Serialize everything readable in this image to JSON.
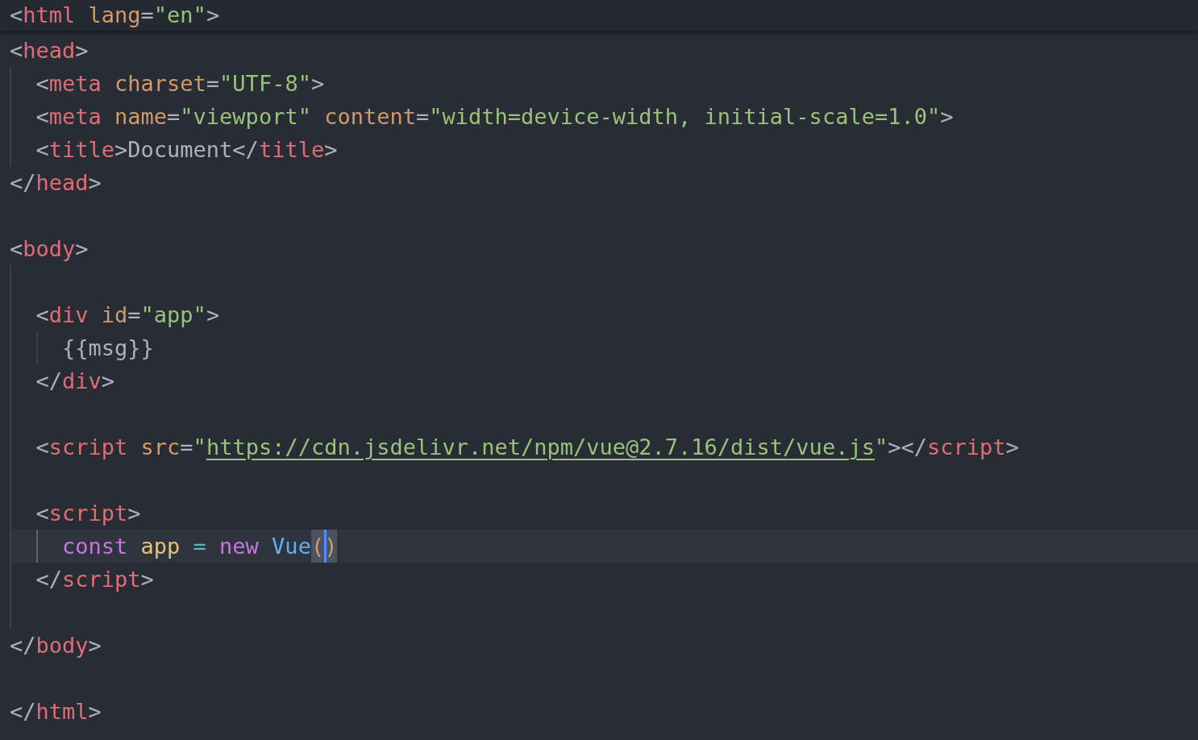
{
  "sticky_line": {
    "tokens": [
      {
        "kind": "punct",
        "text": "<"
      },
      {
        "kind": "tag",
        "text": "html"
      },
      {
        "kind": "attr",
        "text": " lang"
      },
      {
        "kind": "punct",
        "text": "="
      },
      {
        "kind": "string",
        "text": "\"en\""
      },
      {
        "kind": "punct",
        "text": ">"
      }
    ]
  },
  "lines": [
    {
      "kind": "code",
      "tokens": [
        {
          "kind": "punct",
          "text": "<"
        },
        {
          "kind": "tag",
          "text": "head"
        },
        {
          "kind": "punct",
          "text": ">"
        }
      ]
    },
    {
      "kind": "code",
      "tokens": [
        {
          "kind": "guide"
        },
        {
          "kind": "punct",
          "text": "<"
        },
        {
          "kind": "tag",
          "text": "meta"
        },
        {
          "kind": "attr",
          "text": " charset"
        },
        {
          "kind": "punct",
          "text": "="
        },
        {
          "kind": "string",
          "text": "\"UTF-8\""
        },
        {
          "kind": "punct",
          "text": ">"
        }
      ]
    },
    {
      "kind": "code",
      "tokens": [
        {
          "kind": "guide"
        },
        {
          "kind": "punct",
          "text": "<"
        },
        {
          "kind": "tag",
          "text": "meta"
        },
        {
          "kind": "attr",
          "text": " name"
        },
        {
          "kind": "punct",
          "text": "="
        },
        {
          "kind": "string",
          "text": "\"viewport\""
        },
        {
          "kind": "attr",
          "text": " content"
        },
        {
          "kind": "punct",
          "text": "="
        },
        {
          "kind": "string",
          "text": "\"width=device-width, initial-scale=1.0\""
        },
        {
          "kind": "punct",
          "text": ">"
        }
      ]
    },
    {
      "kind": "code",
      "tokens": [
        {
          "kind": "guide"
        },
        {
          "kind": "punct",
          "text": "<"
        },
        {
          "kind": "tag",
          "text": "title"
        },
        {
          "kind": "punct",
          "text": ">"
        },
        {
          "kind": "text",
          "text": "Document"
        },
        {
          "kind": "punct",
          "text": "</"
        },
        {
          "kind": "tag",
          "text": "title"
        },
        {
          "kind": "punct",
          "text": ">"
        }
      ]
    },
    {
      "kind": "code",
      "tokens": [
        {
          "kind": "punct",
          "text": "</"
        },
        {
          "kind": "tag",
          "text": "head"
        },
        {
          "kind": "punct",
          "text": ">"
        }
      ]
    },
    {
      "kind": "blank"
    },
    {
      "kind": "code",
      "tokens": [
        {
          "kind": "punct",
          "text": "<"
        },
        {
          "kind": "tag",
          "text": "body"
        },
        {
          "kind": "punct",
          "text": ">"
        }
      ]
    },
    {
      "kind": "code",
      "tokens": [
        {
          "kind": "guide"
        }
      ]
    },
    {
      "kind": "code",
      "tokens": [
        {
          "kind": "guide"
        },
        {
          "kind": "punct",
          "text": "<"
        },
        {
          "kind": "tag",
          "text": "div"
        },
        {
          "kind": "attr",
          "text": " id"
        },
        {
          "kind": "punct",
          "text": "="
        },
        {
          "kind": "string",
          "text": "\"app\""
        },
        {
          "kind": "punct",
          "text": ">"
        }
      ]
    },
    {
      "kind": "code",
      "tokens": [
        {
          "kind": "guide"
        },
        {
          "kind": "guide"
        },
        {
          "kind": "text",
          "text": "{{msg}}"
        }
      ]
    },
    {
      "kind": "code",
      "tokens": [
        {
          "kind": "guide"
        },
        {
          "kind": "punct",
          "text": "</"
        },
        {
          "kind": "tag",
          "text": "div"
        },
        {
          "kind": "punct",
          "text": ">"
        }
      ]
    },
    {
      "kind": "code",
      "tokens": [
        {
          "kind": "guide"
        }
      ]
    },
    {
      "kind": "code",
      "tokens": [
        {
          "kind": "guide"
        },
        {
          "kind": "punct",
          "text": "<"
        },
        {
          "kind": "tag",
          "text": "script"
        },
        {
          "kind": "attr",
          "text": " src"
        },
        {
          "kind": "punct",
          "text": "="
        },
        {
          "kind": "string",
          "text": "\""
        },
        {
          "kind": "link",
          "text": "https://cdn.jsdelivr.net/npm/vue@2.7.16/dist/vue.js"
        },
        {
          "kind": "string",
          "text": "\""
        },
        {
          "kind": "punct",
          "text": "></"
        },
        {
          "kind": "tag",
          "text": "script"
        },
        {
          "kind": "punct",
          "text": ">"
        }
      ]
    },
    {
      "kind": "code",
      "tokens": [
        {
          "kind": "guide"
        }
      ]
    },
    {
      "kind": "code",
      "tokens": [
        {
          "kind": "guide"
        },
        {
          "kind": "punct",
          "text": "<"
        },
        {
          "kind": "tag",
          "text": "script"
        },
        {
          "kind": "punct",
          "text": ">"
        }
      ]
    },
    {
      "kind": "code",
      "tokens": [
        {
          "kind": "guide"
        },
        {
          "kind": "guide"
        },
        {
          "kind": "keyword",
          "text": "const"
        },
        {
          "kind": "variable",
          "text": " app"
        },
        {
          "kind": "operator",
          "text": " ="
        },
        {
          "kind": "keyword",
          "text": " new"
        },
        {
          "kind": "class",
          "text": " Vue"
        },
        {
          "kind": "bracket",
          "text": "(",
          "caret_before": false
        },
        {
          "kind": "bracket",
          "text": ")",
          "caret_before": true
        }
      ]
    },
    {
      "kind": "code",
      "tokens": [
        {
          "kind": "guide"
        },
        {
          "kind": "punct",
          "text": "</"
        },
        {
          "kind": "tag",
          "text": "script"
        },
        {
          "kind": "punct",
          "text": ">"
        }
      ]
    },
    {
      "kind": "code",
      "tokens": [
        {
          "kind": "guide"
        }
      ]
    },
    {
      "kind": "code",
      "tokens": [
        {
          "kind": "punct",
          "text": "</"
        },
        {
          "kind": "tag",
          "text": "body"
        },
        {
          "kind": "punct",
          "text": ">"
        }
      ]
    },
    {
      "kind": "blank"
    },
    {
      "kind": "code",
      "tokens": [
        {
          "kind": "punct",
          "text": "</"
        },
        {
          "kind": "tag",
          "text": "html"
        },
        {
          "kind": "punct",
          "text": ">"
        }
      ]
    }
  ]
}
